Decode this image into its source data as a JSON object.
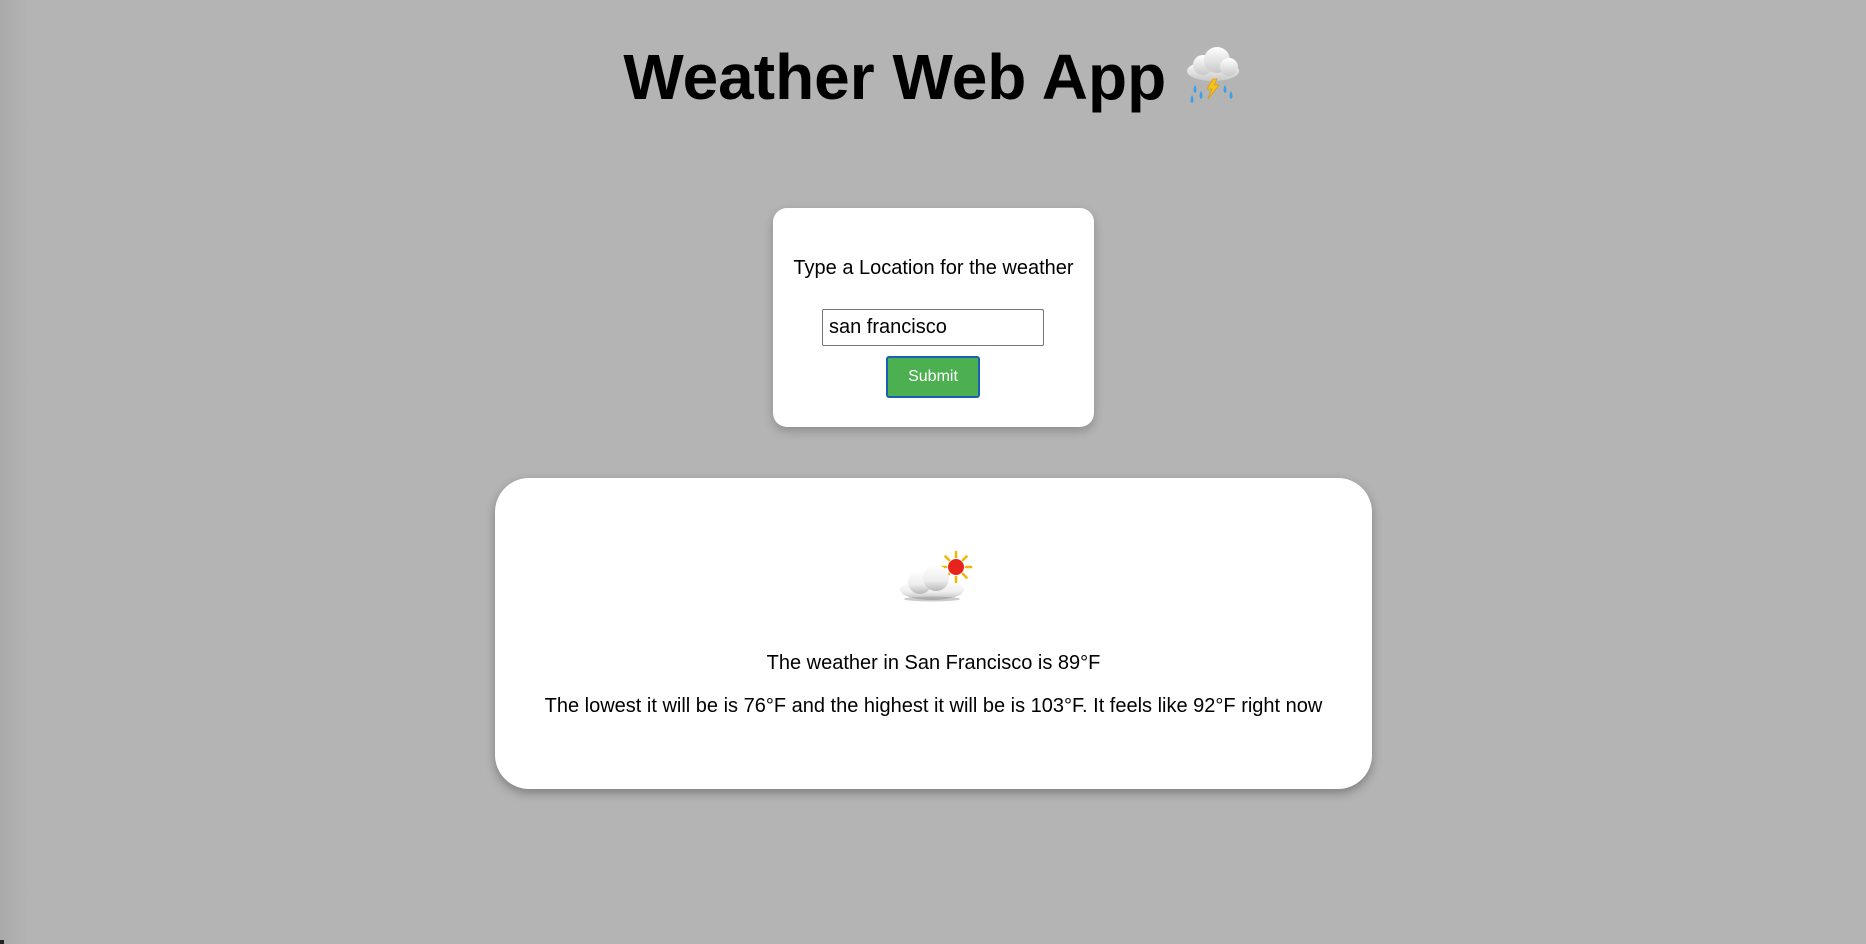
{
  "header": {
    "title": "Weather Web App",
    "title_icon": "cloud-with-lightning-and-rain-icon"
  },
  "search_form": {
    "prompt": "Type a Location for the weather",
    "input_value": "san francisco",
    "submit_label": "Submit"
  },
  "result": {
    "icon": "sun-behind-cloud-icon",
    "summary": "The weather in San Francisco is 89°F",
    "details": "The lowest it will be is 76°F and the highest it will be is 103°F. It feels like 92°F right now"
  },
  "colors": {
    "page_background": "#b4b4b4",
    "card_background": "#ffffff",
    "submit_button": "#4caf50",
    "submit_border": "#1a5fb4"
  }
}
